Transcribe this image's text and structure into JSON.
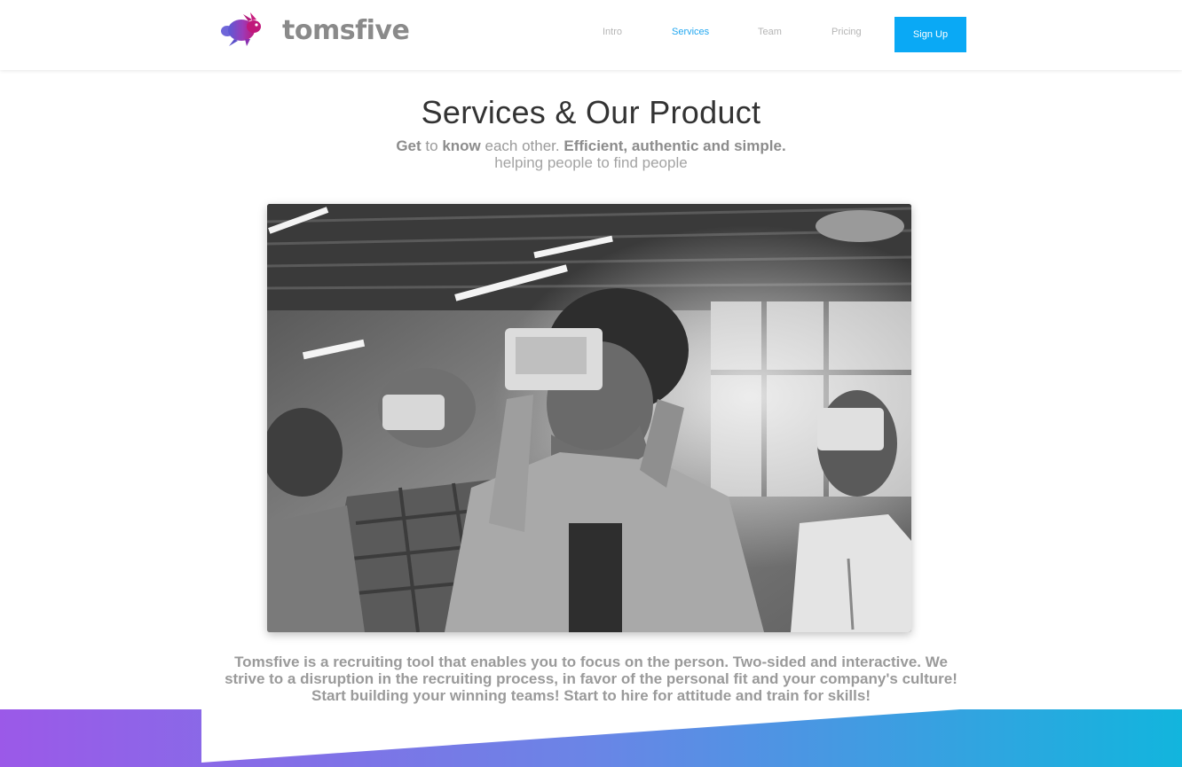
{
  "brand": {
    "name": "tomsfive",
    "logo_icon": "rabbit-logo-icon"
  },
  "nav": {
    "items": [
      {
        "label": "Intro",
        "active": false
      },
      {
        "label": "Services",
        "active": true
      },
      {
        "label": "Team",
        "active": false
      },
      {
        "label": "Pricing",
        "active": false
      }
    ],
    "signup_label": "Sign Up"
  },
  "section": {
    "title": "Services & Our Product",
    "subtitle": {
      "w1": "Get",
      "w2": "to",
      "w3": "know",
      "w4": "each other.",
      "w5": "Efficient, authentic and simple.",
      "line2": "helping people to find people"
    },
    "image_description": "people-wearing-cardboard-vr-headsets-photo",
    "description": "Tomsfive is a recruiting tool that enables you to focus on the person. Two-sided and interactive. We strive to a disruption in the recruiting process, in favor of the personal fit and your company's culture! Start building your winning teams! Start to hire for attitude and train for skills!"
  },
  "colors": {
    "accent": "#0aa9f5",
    "nav_active": "#22a7f0",
    "gradient_start": "#9b59e8",
    "gradient_end": "#12b5dd"
  }
}
